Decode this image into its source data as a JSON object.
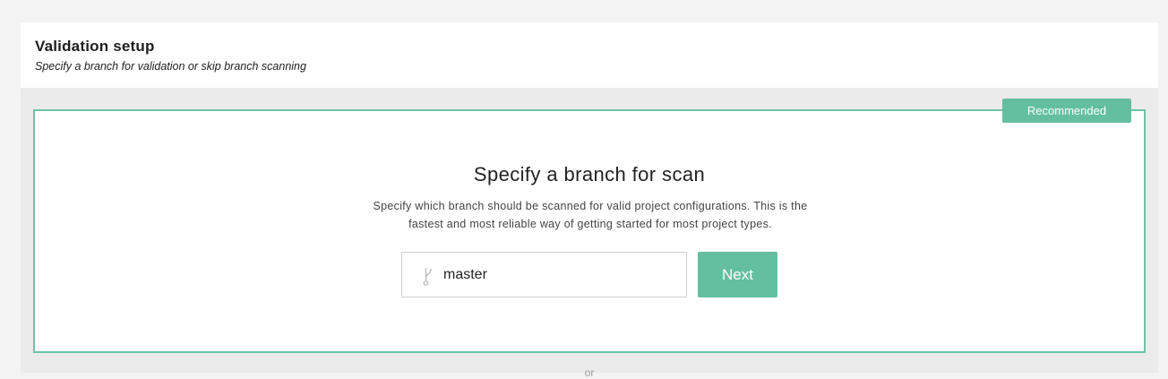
{
  "header": {
    "title": "Validation setup",
    "subtitle": "Specify a branch for validation or skip branch scanning"
  },
  "scan_option": {
    "badge": "Recommended",
    "title": "Specify a branch for scan",
    "description": "Specify which branch should be scanned for valid project configurations. This is the fastest and most reliable way of getting started for most project types.",
    "branch_icon": "git-branch-icon",
    "branch_value": "master",
    "next_label": "Next"
  },
  "divider": {
    "text": "or"
  },
  "colors": {
    "accent": "#63bf9f",
    "card_border": "#6cc3a6",
    "panel_bg": "#ebebeb"
  }
}
